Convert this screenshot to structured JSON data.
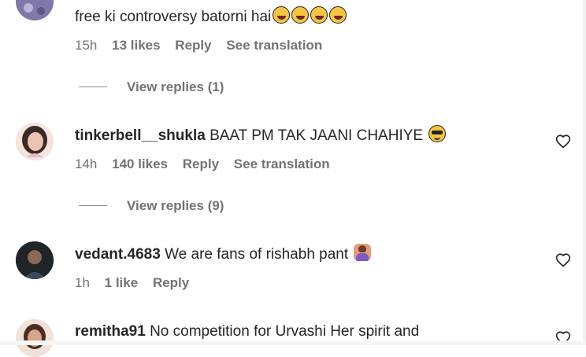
{
  "comments": [
    {
      "text": "free ki controversy batorni hai",
      "time": "15h",
      "likes": "13 likes",
      "reply": "Reply",
      "translate": "See translation",
      "view_replies": "View replies (1)"
    },
    {
      "username": "tinkerbell__shukla",
      "text": "BAAT PM TAK JAANI CHAHIYE",
      "time": "14h",
      "likes": "140 likes",
      "reply": "Reply",
      "translate": "See translation",
      "view_replies": "View replies (9)"
    },
    {
      "username": "vedant.4683",
      "text": "We are fans of rishabh pant",
      "time": "1h",
      "likes": "1 like",
      "reply": "Reply"
    },
    {
      "username": "remitha91",
      "text": "No competition for Urvashi Her spirit and"
    }
  ],
  "icons": {
    "heart": "heart-outline-icon",
    "laugh": "rolling-laughing-emoji",
    "cool": "sunglasses-emoji",
    "raise": "person-raising-hand-emoji"
  }
}
